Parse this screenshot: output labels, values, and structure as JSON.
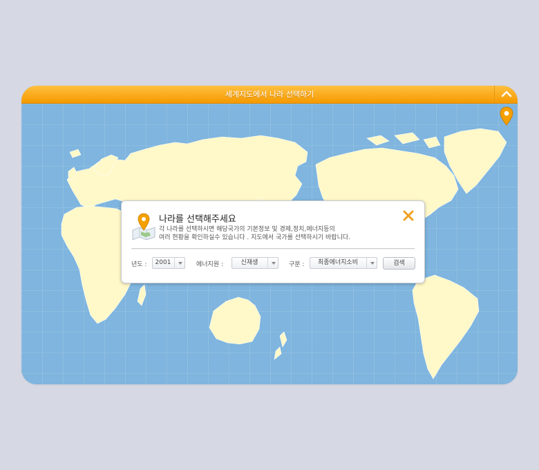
{
  "window": {
    "title": "세계지도에서 나라 선택하기"
  },
  "dialog": {
    "title": "나라를 선택해주세요",
    "desc_line1": "각 나라를 선택하시면 해당국가의 기본정보 및 경제,정치,에너지등의",
    "desc_line2": "여러 현황을 확인하실수 있습니다 . 지도에서 국가를 선택하시기 바랍니다.",
    "year_label": "년도 :",
    "year_value": "2001",
    "energy_label": "에너지원 :",
    "energy_value": "신재생",
    "type_label": "구분 :",
    "type_value": "최종에너지소비",
    "search_label": "검색"
  },
  "colors": {
    "ocean": "#7fb5de",
    "land": "#fff8c8",
    "accent": "#f59a00",
    "background": "#d6d8e4"
  },
  "icons": {
    "collapse": "chevron-up-icon",
    "pin": "map-pin-icon",
    "dialog": "map-icon",
    "close": "close-icon"
  }
}
